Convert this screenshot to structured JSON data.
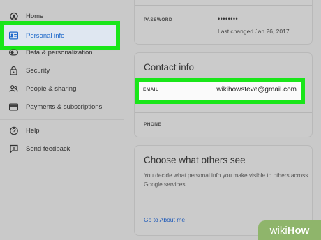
{
  "sidebar": {
    "items": [
      {
        "label": "Home",
        "icon": "home-icon"
      },
      {
        "label": "Personal info",
        "icon": "id-card-icon"
      },
      {
        "label": "Data & personalization",
        "icon": "toggle-icon"
      },
      {
        "label": "Security",
        "icon": "lock-icon"
      },
      {
        "label": "People & sharing",
        "icon": "people-icon"
      },
      {
        "label": "Payments & subscriptions",
        "icon": "credit-card-icon"
      },
      {
        "label": "Help",
        "icon": "help-icon"
      },
      {
        "label": "Send feedback",
        "icon": "feedback-icon"
      }
    ]
  },
  "password": {
    "label": "PASSWORD",
    "value": "••••••••",
    "last_changed": "Last changed Jan 26, 2017"
  },
  "contact": {
    "title": "Contact info",
    "email_label": "EMAIL",
    "email_value": "wikihowsteve@gmail.com",
    "phone_label": "PHONE"
  },
  "choose": {
    "title": "Choose what others see",
    "description": "You decide what personal info you make visible to others across Google services",
    "link": "Go to About me"
  },
  "watermark": {
    "wiki": "wiki",
    "how": "How"
  },
  "colors": {
    "highlight": "#19e619",
    "link": "#1a57b8",
    "background": "#c9c9c9"
  }
}
